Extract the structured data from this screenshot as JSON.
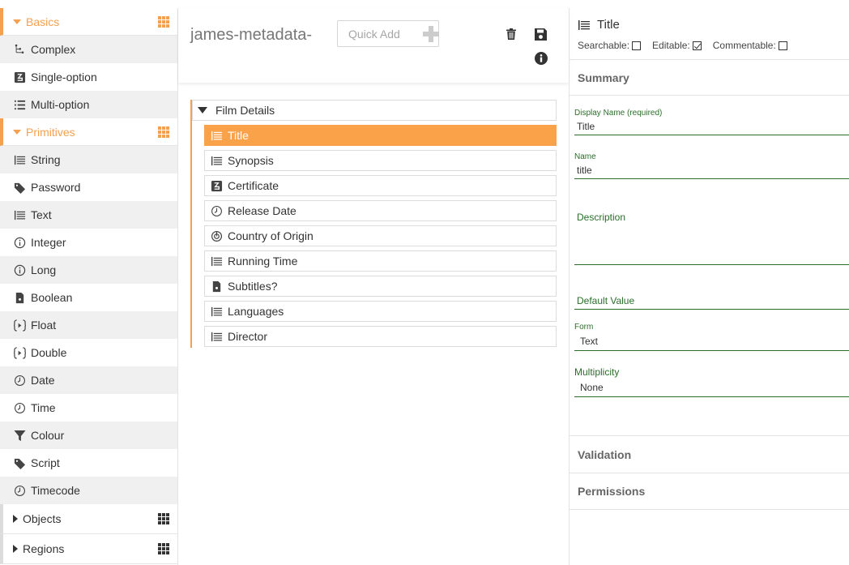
{
  "sidebar": {
    "basics": {
      "label": "Basics",
      "items": [
        {
          "label": "Complex",
          "icon": "complex-icon"
        },
        {
          "label": "Single-option",
          "icon": "single-option-icon"
        },
        {
          "label": "Multi-option",
          "icon": "list-icon"
        }
      ]
    },
    "primitives": {
      "label": "Primitives",
      "items": [
        {
          "label": "String",
          "icon": "text-lines-icon"
        },
        {
          "label": "Password",
          "icon": "tag-icon"
        },
        {
          "label": "Text",
          "icon": "text-lines-icon"
        },
        {
          "label": "Integer",
          "icon": "info-circle-icon"
        },
        {
          "label": "Long",
          "icon": "info-circle-icon"
        },
        {
          "label": "Boolean",
          "icon": "file-icon"
        },
        {
          "label": "Float",
          "icon": "float-icon"
        },
        {
          "label": "Double",
          "icon": "float-icon"
        },
        {
          "label": "Date",
          "icon": "clock-icon"
        },
        {
          "label": "Time",
          "icon": "clock-icon"
        },
        {
          "label": "Colour",
          "icon": "filter-icon"
        },
        {
          "label": "Script",
          "icon": "tag-icon"
        },
        {
          "label": "Timecode",
          "icon": "clock-icon"
        }
      ]
    },
    "objects": {
      "label": "Objects"
    },
    "regions": {
      "label": "Regions"
    }
  },
  "middle": {
    "schema_name": "james-metadata-",
    "quick_add_placeholder": "Quick Add",
    "tree": {
      "root_label": "Film Details",
      "fields": [
        {
          "label": "Title",
          "icon": "text-lines-icon",
          "selected": true
        },
        {
          "label": "Synopsis",
          "icon": "text-lines-icon"
        },
        {
          "label": "Certificate",
          "icon": "single-option-icon"
        },
        {
          "label": "Release Date",
          "icon": "clock-icon"
        },
        {
          "label": "Country of Origin",
          "icon": "link-icon"
        },
        {
          "label": "Running Time",
          "icon": "text-lines-icon"
        },
        {
          "label": "Subtitles?",
          "icon": "file-icon"
        },
        {
          "label": "Languages",
          "icon": "text-lines-icon"
        },
        {
          "label": "Director",
          "icon": "text-lines-icon"
        }
      ]
    }
  },
  "right": {
    "title": "Title",
    "flags": {
      "searchable": "Searchable:",
      "editable": "Editable:",
      "commentable": "Commentable:",
      "searchable_checked": false,
      "editable_checked": true,
      "commentable_checked": false
    },
    "summary": {
      "title": "Summary",
      "display_name_label": "Display Name (required)",
      "display_name_value": "Title",
      "name_label": "Name",
      "name_value": "title",
      "description_label": "Description",
      "default_value_label": "Default Value",
      "form_label": "Form",
      "form_value": "Text",
      "multiplicity_label": "Multiplicity",
      "multiplicity_value": "None"
    },
    "validation_title": "Validation",
    "permissions_title": "Permissions"
  },
  "colors": {
    "accent": "#f5a050",
    "selected": "#f9a24a",
    "label_green": "#2b6d2b"
  }
}
